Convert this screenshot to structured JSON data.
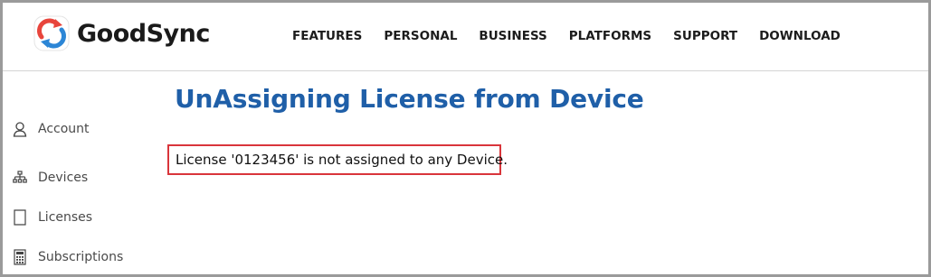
{
  "brand": {
    "name": "GoodSync",
    "logo_icon": "goodsync-sync-logo-icon"
  },
  "nav": {
    "items": [
      {
        "label": "FEATURES"
      },
      {
        "label": "PERSONAL"
      },
      {
        "label": "BUSINESS"
      },
      {
        "label": "PLATFORMS"
      },
      {
        "label": "SUPPORT"
      },
      {
        "label": "DOWNLOAD"
      }
    ]
  },
  "sidebar": {
    "items": [
      {
        "label": "Account",
        "icon": "user-icon"
      },
      {
        "label": "Devices",
        "icon": "network-icon"
      },
      {
        "label": "Licenses",
        "icon": "document-icon"
      },
      {
        "label": "Subscriptions",
        "icon": "calculator-icon"
      }
    ]
  },
  "main": {
    "title": "UnAssigning License from Device",
    "message": "License '0123456' is not assigned to any Device."
  },
  "colors": {
    "title": "#1f5fa8",
    "highlight_border": "#d9353b",
    "logo_red": "#e8453c",
    "logo_blue": "#2c86d6"
  }
}
